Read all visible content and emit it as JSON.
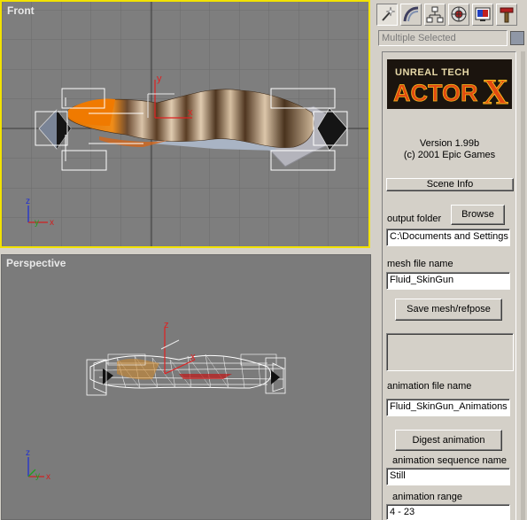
{
  "viewports": {
    "front": {
      "label": "Front"
    },
    "perspective": {
      "label": "Perspective"
    },
    "axis": {
      "x": "x",
      "y": "y",
      "z": "z"
    }
  },
  "command_panel": {
    "tabs": [
      {
        "icon": "create-wand-icon"
      },
      {
        "icon": "modify-curve-icon"
      },
      {
        "icon": "hierarchy-icon"
      },
      {
        "icon": "motion-icon"
      },
      {
        "icon": "display-icon"
      },
      {
        "icon": "utilities-hammer-icon"
      }
    ],
    "selection_field": "Multiple Selected",
    "selection_color": "#8f97a6"
  },
  "actorx": {
    "logo_top": "UNREAL TECH",
    "logo_bottom": "ACTOR",
    "logo_x": "X",
    "version": "Version 1.99b",
    "copyright": "(c) 2001  Epic Games",
    "scene_info_button": "Scene Info",
    "output_folder_label": "output folder",
    "browse_button": "Browse",
    "output_folder_value": "C:\\Documents and Settings",
    "mesh_file_label": "mesh file name",
    "mesh_file_value": "Fluid_SkinGun",
    "save_mesh_button": "Save mesh/refpose",
    "animation_file_label": "animation file name",
    "animation_file_value": "Fluid_SkinGun_Animations",
    "digest_button": "Digest animation",
    "sequence_label": "animation sequence name",
    "sequence_value": "Still",
    "range_label": "animation range",
    "range_value": "4 - 23"
  }
}
